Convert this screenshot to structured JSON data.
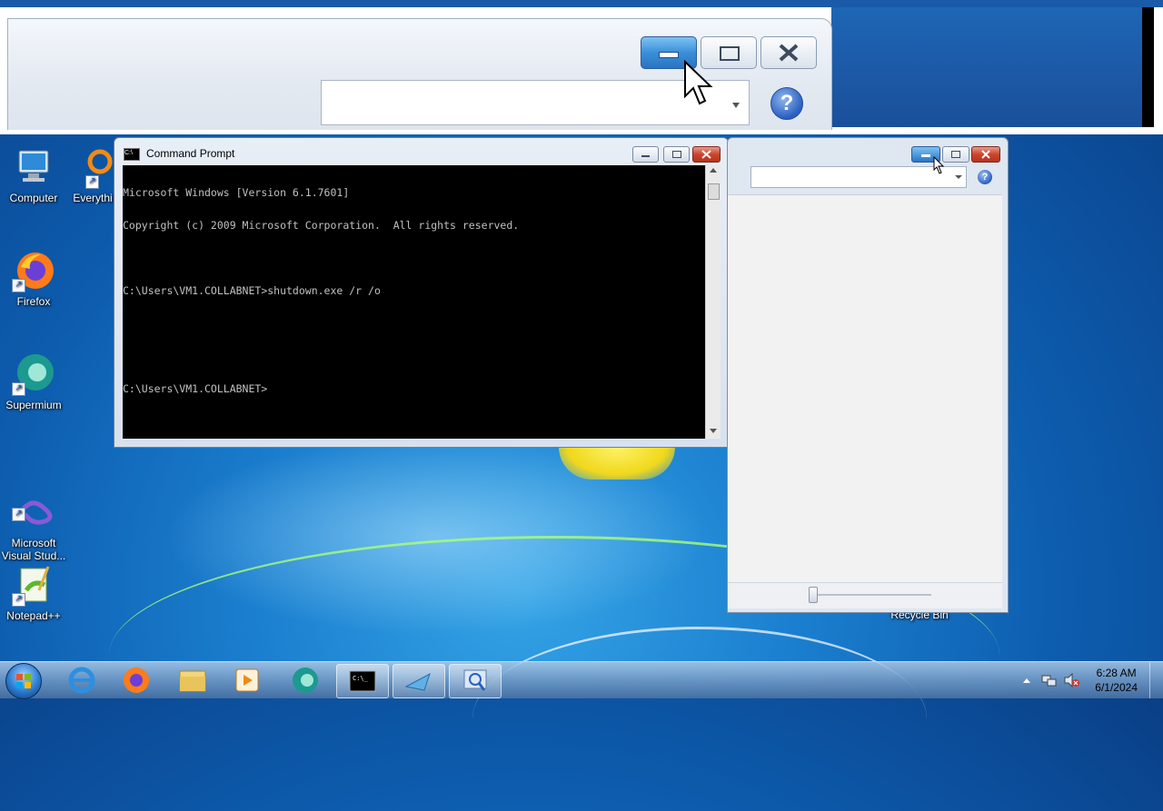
{
  "desktop": {
    "icons": [
      {
        "label": "Computer"
      },
      {
        "label": "Everythi"
      },
      {
        "label": "Firefox"
      },
      {
        "label": "Supermium"
      },
      {
        "label": "Microsoft\nVisual Stud..."
      },
      {
        "label": "Notepad++"
      },
      {
        "label": "Recycle Bin"
      }
    ]
  },
  "cmd_window": {
    "title": "Command Prompt",
    "lines": [
      "Microsoft Windows [Version 6.1.7601]",
      "Copyright (c) 2009 Microsoft Corporation.  All rights reserved.",
      "",
      "C:\\Users\\VM1.COLLABNET>shutdown.exe /r /o",
      "",
      "",
      "C:\\Users\\VM1.COLLABNET>"
    ]
  },
  "taskbar": {
    "clock_time": "6:28 AM",
    "clock_date": "6/1/2024",
    "icons": [
      "start-orb",
      "internet-explorer",
      "firefox",
      "file-explorer",
      "media-player",
      "supermium",
      "command-prompt",
      "paint-tool",
      "magnifier"
    ]
  },
  "colors": {
    "desktop_blue": "#1b7fcf",
    "taskbar": "#6e96c3",
    "close_red": "#c9452e",
    "minimize_blue": "#3a8fd8"
  }
}
